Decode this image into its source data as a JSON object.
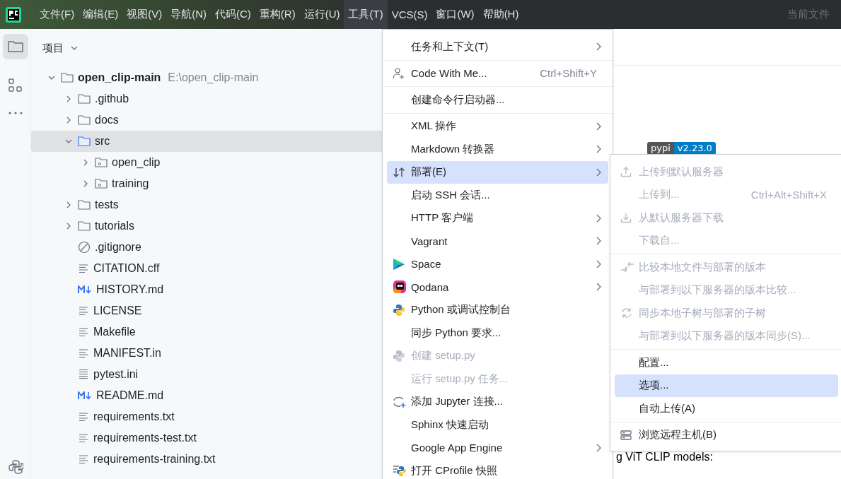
{
  "menubar": {
    "items": [
      {
        "label": "文件(F)",
        "selected": false
      },
      {
        "label": "编辑(E)",
        "selected": false
      },
      {
        "label": "视图(V)",
        "selected": false
      },
      {
        "label": "导航(N)",
        "selected": false
      },
      {
        "label": "代码(C)",
        "selected": false
      },
      {
        "label": "重构(R)",
        "selected": false
      },
      {
        "label": "运行(U)",
        "selected": false
      },
      {
        "label": "工具(T)",
        "selected": true
      },
      {
        "label": "VCS(S)",
        "selected": false
      },
      {
        "label": "窗口(W)",
        "selected": false
      },
      {
        "label": "帮助(H)",
        "selected": false
      }
    ],
    "right_label": "当前文件"
  },
  "project": {
    "title": "项目",
    "tree": [
      {
        "name": "open_clip-main",
        "path": "E:\\open_clip-main",
        "kind": "folder",
        "expanded": true,
        "selected": false,
        "children": [
          {
            "name": ".github",
            "kind": "folder",
            "expanded": false,
            "selected": false
          },
          {
            "name": "docs",
            "kind": "folder",
            "expanded": false,
            "selected": false
          },
          {
            "name": "src",
            "kind": "folder",
            "expanded": true,
            "selected": true,
            "children": [
              {
                "name": "open_clip",
                "kind": "module",
                "expanded": false,
                "selected": false
              },
              {
                "name": "training",
                "kind": "module",
                "expanded": false,
                "selected": false
              }
            ]
          },
          {
            "name": "tests",
            "kind": "folder",
            "expanded": false,
            "selected": false
          },
          {
            "name": "tutorials",
            "kind": "folder",
            "expanded": false,
            "selected": false
          },
          {
            "name": ".gitignore",
            "kind": "ignore",
            "selected": false
          },
          {
            "name": "CITATION.cff",
            "kind": "text",
            "selected": false
          },
          {
            "name": "HISTORY.md",
            "kind": "markdown",
            "selected": false
          },
          {
            "name": "LICENSE",
            "kind": "text",
            "selected": false
          },
          {
            "name": "Makefile",
            "kind": "text",
            "selected": false
          },
          {
            "name": "MANIFEST.in",
            "kind": "text",
            "selected": false
          },
          {
            "name": "pytest.ini",
            "kind": "ini",
            "selected": false
          },
          {
            "name": "README.md",
            "kind": "markdown",
            "selected": false
          },
          {
            "name": "requirements.txt",
            "kind": "text",
            "selected": false
          },
          {
            "name": "requirements-test.txt",
            "kind": "text",
            "selected": false
          },
          {
            "name": "requirements-training.txt",
            "kind": "text",
            "selected": false
          }
        ]
      }
    ]
  },
  "editor": {
    "badge": {
      "label": "pypi",
      "value": "v2.23.0"
    },
    "text": "g ViT CLIP models:"
  },
  "tools_menu": {
    "groups": [
      [
        {
          "label": "任务和上下文(T)",
          "submenu": true,
          "disabled": false,
          "selected": false
        }
      ],
      [
        {
          "label": "Code With Me...",
          "shortcut": "Ctrl+Shift+Y",
          "submenu": false,
          "disabled": false,
          "selected": false
        }
      ],
      [
        {
          "label": "创建命令行启动器...",
          "submenu": false,
          "disabled": false,
          "selected": false
        }
      ],
      [
        {
          "label": "XML 操作",
          "submenu": true,
          "disabled": false,
          "selected": false
        },
        {
          "label": "Markdown 转换器",
          "submenu": true,
          "disabled": false,
          "selected": false
        },
        {
          "label": "部署(E)",
          "submenu": true,
          "disabled": false,
          "selected": true
        },
        {
          "label": "启动 SSH 会话...",
          "submenu": false,
          "disabled": false,
          "selected": false
        },
        {
          "label": "HTTP 客户端",
          "submenu": true,
          "disabled": false,
          "selected": false
        },
        {
          "label": "Vagrant",
          "submenu": true,
          "disabled": false,
          "selected": false
        },
        {
          "label": "Space",
          "submenu": true,
          "disabled": false,
          "selected": false
        },
        {
          "label": "Qodana",
          "submenu": true,
          "disabled": false,
          "selected": false
        },
        {
          "label": "Python 或调试控制台",
          "submenu": false,
          "disabled": false,
          "selected": false
        },
        {
          "label": "同步 Python 要求...",
          "submenu": false,
          "disabled": false,
          "selected": false
        },
        {
          "label": "创建 setup.py",
          "submenu": false,
          "disabled": true,
          "selected": false
        },
        {
          "label": "运行 setup.py 任务...",
          "submenu": false,
          "disabled": true,
          "selected": false
        },
        {
          "label": "添加 Jupyter 连接...",
          "submenu": false,
          "disabled": false,
          "selected": false
        },
        {
          "label": "Sphinx 快速启动",
          "submenu": false,
          "disabled": false,
          "selected": false
        },
        {
          "label": "Google App Engine",
          "submenu": true,
          "disabled": false,
          "selected": false
        },
        {
          "label": "打开 CProfile 快照",
          "submenu": false,
          "disabled": false,
          "selected": false
        }
      ]
    ]
  },
  "deploy_submenu": {
    "groups": [
      [
        {
          "label": "上传到默认服务器",
          "disabled": true,
          "selected": false
        },
        {
          "label": "上传到...",
          "shortcut": "Ctrl+Alt+Shift+X",
          "disabled": true,
          "selected": false
        },
        {
          "label": "从默认服务器下载",
          "disabled": true,
          "selected": false
        },
        {
          "label": "下载自...",
          "disabled": true,
          "selected": false
        }
      ],
      [
        {
          "label": "比较本地文件与部署的版本",
          "disabled": true,
          "selected": false
        },
        {
          "label": "与部署到以下服务器的版本比较...",
          "disabled": true,
          "selected": false
        },
        {
          "label": "同步本地子树与部署的子树",
          "disabled": true,
          "selected": false
        },
        {
          "label": "与部署到以下服务器的版本同步(S)...",
          "disabled": true,
          "selected": false
        }
      ],
      [
        {
          "label": "配置...",
          "disabled": false,
          "selected": false
        },
        {
          "label": "选项...",
          "disabled": false,
          "selected": true
        },
        {
          "label": "自动上传(A)",
          "disabled": false,
          "selected": false
        }
      ],
      [
        {
          "label": "浏览远程主机(B)",
          "disabled": false,
          "selected": false
        }
      ]
    ]
  }
}
